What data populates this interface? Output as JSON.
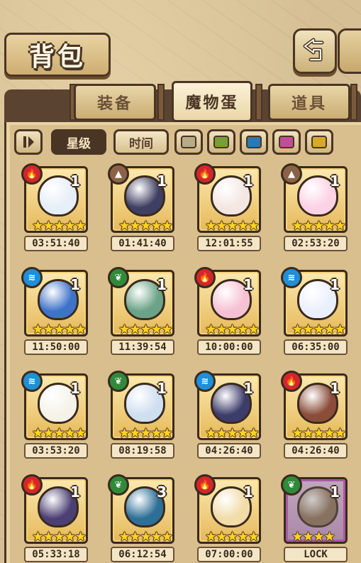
{
  "header": {
    "title": "背包"
  },
  "tabs": [
    {
      "label": "装备",
      "active": false
    },
    {
      "label": "魔物蛋",
      "active": true
    },
    {
      "label": "道具",
      "active": false
    }
  ],
  "filters": {
    "toggle_icon": "toggle-icon",
    "sort_star": "星级",
    "sort_time": "时间",
    "colors": [
      "#b8ab88",
      "#7a9d35",
      "#2e78b0",
      "#c04f97",
      "#d6a92a"
    ]
  },
  "eggs": [
    {
      "element": "fire",
      "count": "1",
      "stars": "★★★★★",
      "timer": "03:51:40",
      "egg_color": "#e6eef8"
    },
    {
      "element": "earth",
      "count": "1",
      "stars": "★★★★★",
      "timer": "01:41:40",
      "egg_color": "#3f3f63"
    },
    {
      "element": "fire",
      "count": "1",
      "stars": "★★★★★",
      "timer": "12:01:55",
      "egg_color": "#f4e7e2"
    },
    {
      "element": "earth",
      "count": "1",
      "stars": "★★★★★",
      "timer": "02:53:20",
      "egg_color": "#fcd2e4"
    },
    {
      "element": "water",
      "count": "1",
      "stars": "★★★★★",
      "timer": "11:50:00",
      "egg_color": "#3f73c8"
    },
    {
      "element": "wood",
      "count": "1",
      "stars": "★★★★★",
      "timer": "11:39:54",
      "egg_color": "#6aa387"
    },
    {
      "element": "fire",
      "count": "1",
      "stars": "★★★★★",
      "timer": "10:00:00",
      "egg_color": "#f6c1d3"
    },
    {
      "element": "water",
      "count": "1",
      "stars": "★★★★★",
      "timer": "06:35:00",
      "egg_color": "#eaf0fb"
    },
    {
      "element": "water",
      "count": "1",
      "stars": "★★★★★",
      "timer": "03:53:20",
      "egg_color": "#f5f3e8"
    },
    {
      "element": "wood",
      "count": "1",
      "stars": "★★★★★",
      "timer": "08:19:58",
      "egg_color": "#cfdff0"
    },
    {
      "element": "water",
      "count": "1",
      "stars": "★★★★★",
      "timer": "04:26:40",
      "egg_color": "#3d3d6b"
    },
    {
      "element": "fire",
      "count": "1",
      "stars": "★★★★★",
      "timer": "04:26:40",
      "egg_color": "#8b4d3a"
    },
    {
      "element": "fire",
      "count": "1",
      "stars": "★★★★★",
      "timer": "05:33:18",
      "egg_color": "#4b3f73"
    },
    {
      "element": "wood",
      "count": "3",
      "stars": "★★★★★",
      "timer": "06:12:54",
      "egg_color": "#2e6f97"
    },
    {
      "element": "fire",
      "count": "1",
      "stars": "★★★★★",
      "timer": "07:00:00",
      "egg_color": "#f2dca8"
    },
    {
      "element": "wood",
      "count": "1",
      "stars": "★★★★",
      "timer": "LOCK",
      "egg_color": "#8f7359",
      "locked": true
    }
  ],
  "element_colors": {
    "fire": "#d3262c",
    "earth": "#8b6245",
    "water": "#1f8fd6",
    "wood": "#2f8a3a"
  },
  "element_icons": {
    "fire": "flame-icon",
    "earth": "mountain-icon",
    "water": "wave-icon",
    "wood": "leaf-icon"
  }
}
